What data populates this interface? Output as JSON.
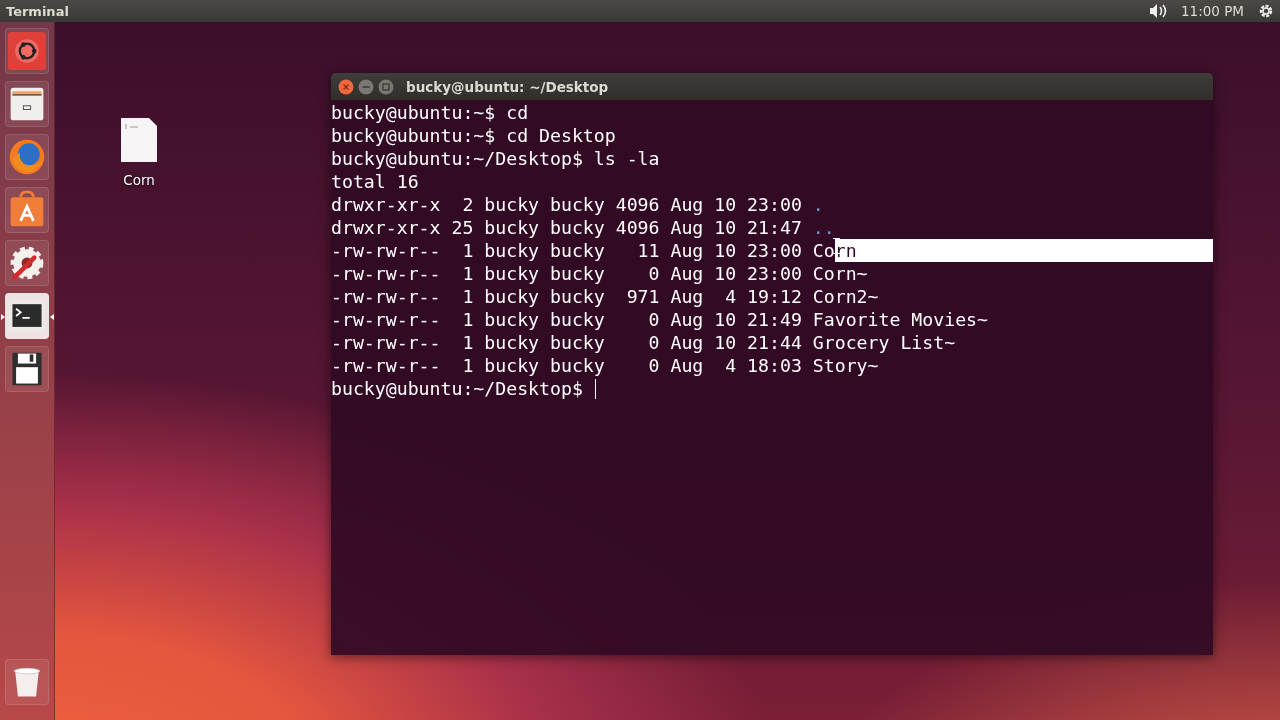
{
  "top_panel": {
    "app_title": "Terminal",
    "clock": "11:00 PM"
  },
  "launcher": [
    {
      "kind": "dash",
      "active": false
    },
    {
      "kind": "files",
      "active": false
    },
    {
      "kind": "browser",
      "active": false
    },
    {
      "kind": "software",
      "active": false
    },
    {
      "kind": "settings",
      "active": false
    },
    {
      "kind": "terminal",
      "active": true
    },
    {
      "kind": "save",
      "active": false
    },
    {
      "kind": "trash",
      "active": false
    }
  ],
  "desktop_icons": [
    {
      "label": "Corn"
    }
  ],
  "window": {
    "title": "bucky@ubuntu: ~/Desktop",
    "lines": [
      {
        "segments": [
          {
            "text": "bucky@ubuntu:~$ cd",
            "kind": "plain"
          }
        ]
      },
      {
        "segments": [
          {
            "text": "bucky@ubuntu:~$ cd Desktop",
            "kind": "plain"
          }
        ]
      },
      {
        "segments": [
          {
            "text": "bucky@ubuntu:~/Desktop$ ls -la",
            "kind": "plain"
          }
        ]
      },
      {
        "segments": [
          {
            "text": "total 16",
            "kind": "plain"
          }
        ]
      },
      {
        "segments": [
          {
            "text": "drwxr-xr-x  2 bucky bucky 4096 Aug 10 23:00 ",
            "kind": "plain"
          },
          {
            "text": ".",
            "kind": "dir"
          }
        ]
      },
      {
        "segments": [
          {
            "text": "drwxr-xr-x 25 bucky bucky 4096 Aug 10 21:47 ",
            "kind": "plain"
          },
          {
            "text": "..",
            "kind": "dir"
          }
        ]
      },
      {
        "segments": [
          {
            "text": "-rw-rw-r--  1 bucky bucky   11 Aug 10 23:00 Co",
            "kind": "plain"
          },
          {
            "text": "rn",
            "kind": "selected"
          }
        ]
      },
      {
        "segments": [
          {
            "text": "-rw-rw-r--  1 bucky bucky    0 Aug 10 23:00 Corn~",
            "kind": "plain"
          }
        ]
      },
      {
        "segments": [
          {
            "text": "-rw-rw-r--  1 bucky bucky  971 Aug  4 19:12 Corn2~",
            "kind": "plain"
          }
        ]
      },
      {
        "segments": [
          {
            "text": "-rw-rw-r--  1 bucky bucky    0 Aug 10 21:49 Favorite Movies~",
            "kind": "plain"
          }
        ]
      },
      {
        "segments": [
          {
            "text": "-rw-rw-r--  1 bucky bucky    0 Aug 10 21:44 Grocery List~",
            "kind": "plain"
          }
        ]
      },
      {
        "segments": [
          {
            "text": "-rw-rw-r--  1 bucky bucky    0 Aug  4 18:03 Story~",
            "kind": "plain"
          }
        ]
      },
      {
        "segments": [
          {
            "text": "bucky@ubuntu:~/Desktop$ ",
            "kind": "plain"
          }
        ],
        "cursor": true
      }
    ]
  }
}
